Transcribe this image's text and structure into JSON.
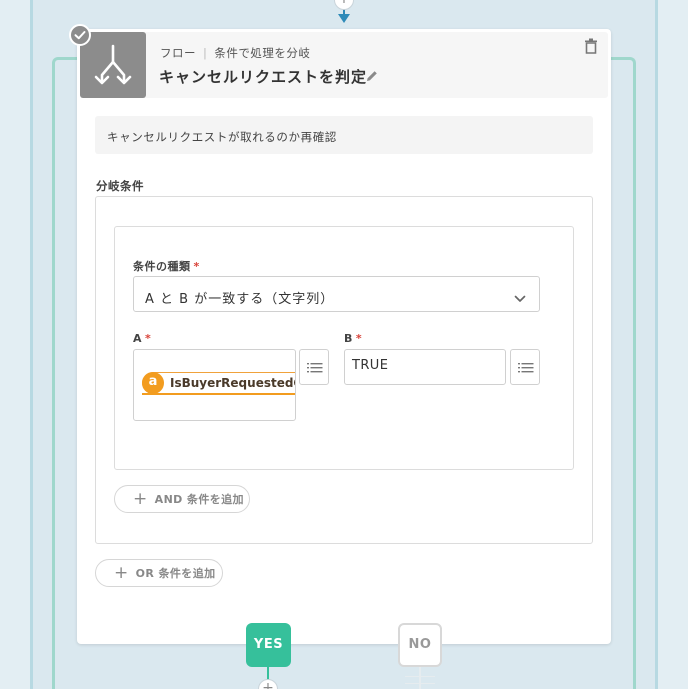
{
  "connector": {
    "plus_symbol": "+"
  },
  "node": {
    "breadcrumb_category": "フロー",
    "breadcrumb_separator": "|",
    "breadcrumb_type": "条件で処理を分岐",
    "title": "キャンセルリクエストを判定",
    "description": "キャンセルリクエストが取れるのか再確認",
    "status": "completed"
  },
  "conditions": {
    "section_label": "分岐条件",
    "type_label": "条件の種類",
    "required_mark": "*",
    "type_value": "A と B が一致する（文字列）",
    "a_label": "A",
    "b_label": "B",
    "a_token_icon": "a",
    "a_token_text": "IsBuyerRequestedCancel",
    "b_value": "TRUE",
    "add_and_label": "AND 条件を追加",
    "add_or_label": "OR 条件を追加",
    "plus_symbol": "+"
  },
  "branches": {
    "yes_label": "YES",
    "no_label": "NO"
  },
  "colors": {
    "accent_green": "#36c09b",
    "amazon_orange": "#f29c1f",
    "required_red": "#d9433a",
    "connector_blue": "#2d8ab8"
  },
  "icons": [
    "branch-flow-icon",
    "check-icon",
    "edit-pencil-icon",
    "trash-icon",
    "chevron-down-icon",
    "list-icon",
    "amazon-icon",
    "plus-icon"
  ]
}
